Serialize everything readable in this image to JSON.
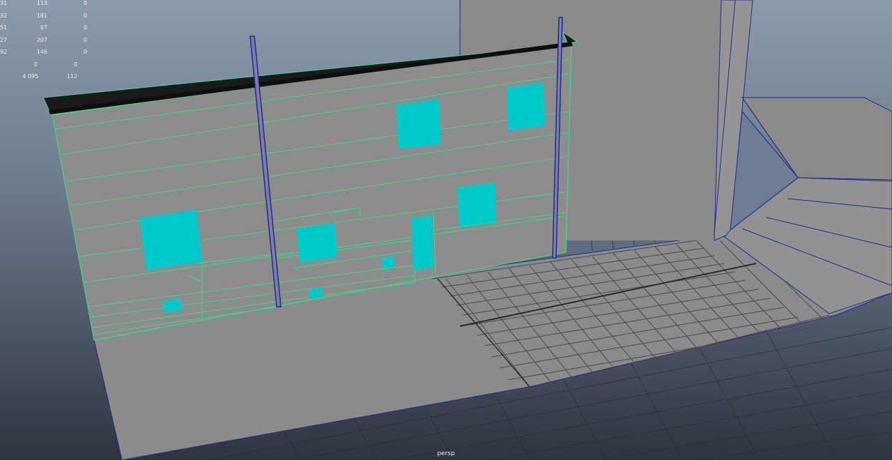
{
  "viewport": {
    "camera_label": "persp"
  },
  "hud": {
    "rows": [
      [
        "31",
        "113",
        "0"
      ],
      [
        "32",
        "181",
        "0"
      ],
      [
        "51",
        "67",
        "0"
      ],
      [
        "27",
        "207",
        "0"
      ],
      [
        "92",
        "146",
        "0"
      ],
      [
        "",
        "0",
        "0"
      ],
      [
        "",
        "4 095",
        "112"
      ]
    ]
  },
  "colors": {
    "background_top": "#8a97aa",
    "background_bottom": "#2f3642",
    "mesh_grey": "#8c8c8c",
    "wireframe_selected": "#33e08a",
    "face_selected": "#00c8c8",
    "edge_blue": "#1e2a8c",
    "grid_line": "#1a1a1a"
  },
  "icons": [
    "house-facade-mesh",
    "pole-mesh",
    "building-mesh",
    "grid-plane"
  ]
}
